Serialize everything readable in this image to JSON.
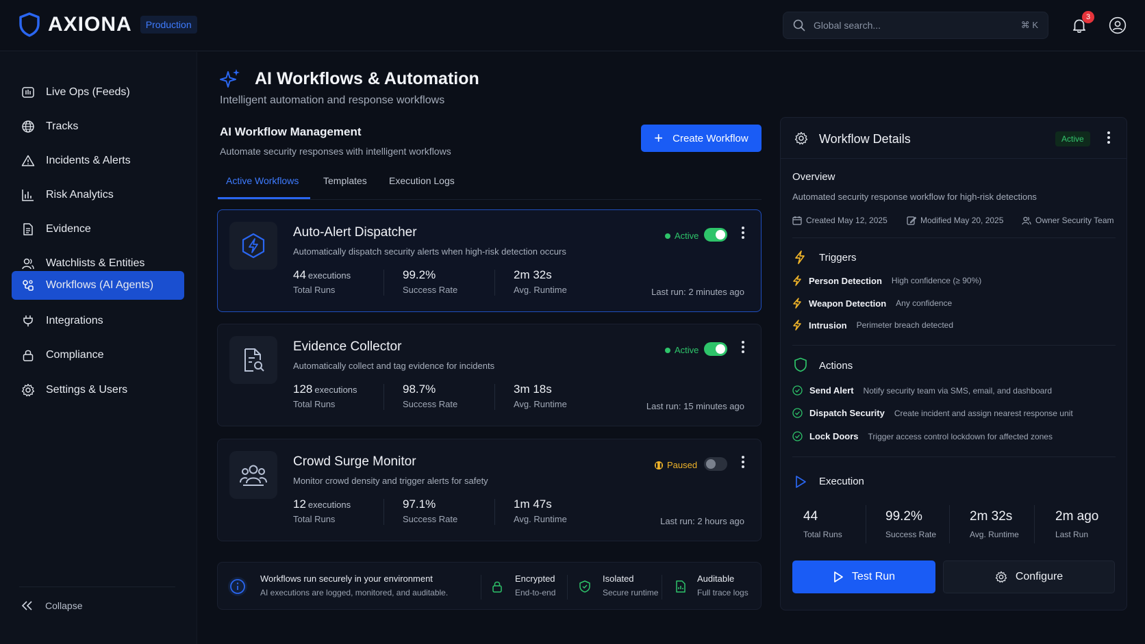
{
  "brand": {
    "name": "AXIONA",
    "env_badge": "Production"
  },
  "header": {
    "search_placeholder": "Global search...",
    "search_shortcut": "⌘ K",
    "notification_count": "3"
  },
  "sidebar": {
    "items": [
      {
        "label": "Live Ops (Feeds)",
        "icon": "monitor-icon"
      },
      {
        "label": "Tracks",
        "icon": "globe-icon"
      },
      {
        "label": "Incidents & Alerts",
        "icon": "warning-icon"
      },
      {
        "label": "Risk Analytics",
        "icon": "bar-chart-icon"
      },
      {
        "label": "Evidence",
        "icon": "document-icon"
      },
      {
        "label": "Watchlists & Entities",
        "icon": "users-icon"
      },
      {
        "label": "Workflows (AI Agents)",
        "icon": "workflow-icon",
        "active": true
      },
      {
        "label": "Integrations",
        "icon": "plug-icon"
      },
      {
        "label": "Compliance",
        "icon": "lock-icon"
      },
      {
        "label": "Settings & Users",
        "icon": "gear-icon"
      }
    ],
    "collapse_label": "Collapse"
  },
  "page": {
    "title": "AI Workflows & Automation",
    "subtitle": "Intelligent automation and response workflows"
  },
  "management": {
    "title": "AI Workflow Management",
    "subtitle": "Automate security responses with intelligent workflows",
    "create_label": "Create Workflow"
  },
  "tabs": [
    {
      "label": "Active Workflows",
      "active": true
    },
    {
      "label": "Templates"
    },
    {
      "label": "Execution Logs"
    }
  ],
  "workflows": [
    {
      "title": "Auto-Alert Dispatcher",
      "description": "Automatically dispatch security alerts when high-risk detection occurs",
      "status": "Active",
      "enabled": true,
      "runs_value": "44",
      "runs_unit": "executions",
      "runs_label": "Total Runs",
      "success_value": "99.2%",
      "success_label": "Success Rate",
      "runtime_value": "2m 32s",
      "runtime_label": "Avg. Runtime",
      "last_run": "Last run: 2 minutes ago"
    },
    {
      "title": "Evidence Collector",
      "description": "Automatically collect and tag evidence for incidents",
      "status": "Active",
      "enabled": true,
      "runs_value": "128",
      "runs_unit": "executions",
      "runs_label": "Total Runs",
      "success_value": "98.7%",
      "success_label": "Success Rate",
      "runtime_value": "3m 18s",
      "runtime_label": "Avg. Runtime",
      "last_run": "Last run: 15 minutes ago"
    },
    {
      "title": "Crowd Surge Monitor",
      "description": "Monitor crowd density and trigger alerts for safety",
      "status": "Paused",
      "enabled": false,
      "runs_value": "12",
      "runs_unit": "executions",
      "runs_label": "Total Runs",
      "success_value": "97.1%",
      "success_label": "Success Rate",
      "runtime_value": "1m 47s",
      "runtime_label": "Avg. Runtime",
      "last_run": "Last run: 2 hours ago"
    }
  ],
  "info_bar": {
    "main_title": "Workflows run securely in your environment",
    "main_sub": "AI executions are logged, monitored, and auditable.",
    "items": [
      {
        "title": "Encrypted",
        "sub": "End-to-end"
      },
      {
        "title": "Isolated",
        "sub": "Secure runtime"
      },
      {
        "title": "Auditable",
        "sub": "Full trace logs"
      }
    ]
  },
  "details": {
    "title": "Workflow Details",
    "status": "Active",
    "overview_title": "Overview",
    "overview_text": "Automated security response workflow for high-risk detections",
    "created": "Created May 12, 2025",
    "modified": "Modified May 20, 2025",
    "owner": "Owner Security Team",
    "triggers_title": "Triggers",
    "triggers": [
      {
        "name": "Person Detection",
        "desc": "High confidence (≥ 90%)"
      },
      {
        "name": "Weapon Detection",
        "desc": "Any confidence"
      },
      {
        "name": "Intrusion",
        "desc": "Perimeter breach detected"
      }
    ],
    "actions_title": "Actions",
    "actions": [
      {
        "name": "Send Alert",
        "desc": "Notify security team via SMS, email, and dashboard"
      },
      {
        "name": "Dispatch Security",
        "desc": "Create incident and assign nearest response unit"
      },
      {
        "name": "Lock Doors",
        "desc": "Trigger access control lockdown for affected zones"
      }
    ],
    "execution_title": "Execution",
    "execution": [
      {
        "value": "44",
        "label": "Total Runs"
      },
      {
        "value": "99.2%",
        "label": "Success Rate"
      },
      {
        "value": "2m 32s",
        "label": "Avg. Runtime"
      },
      {
        "value": "2m ago",
        "label": "Last Run"
      }
    ],
    "test_label": "Test Run",
    "configure_label": "Configure"
  },
  "colors": {
    "accent": "#1a5cf5",
    "active": "#2ec46a",
    "paused": "#f0b429",
    "trigger": "#f0b429",
    "bg": "#0b0f18"
  }
}
